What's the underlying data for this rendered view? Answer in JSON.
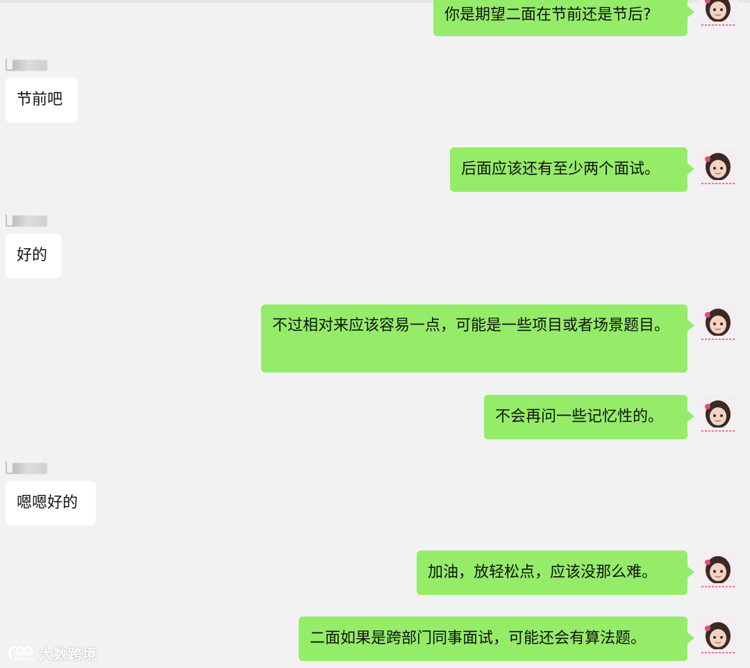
{
  "chat": {
    "messages": [
      {
        "side": "sent",
        "text": "你是期望二面在节前还是节后?"
      },
      {
        "side": "recv",
        "text": "节前吧"
      },
      {
        "side": "sent",
        "text": "后面应该还有至少两个面试。"
      },
      {
        "side": "recv",
        "text": "好的"
      },
      {
        "side": "sent",
        "text": "不过相对来应该容易一点，可能是一些项目或者场景题目。"
      },
      {
        "side": "sent",
        "text": "不会再问一些记忆性的。"
      },
      {
        "side": "recv",
        "text": "嗯嗯好的"
      },
      {
        "side": "sent",
        "text": "加油，放轻松点，应该没那么难。"
      },
      {
        "side": "sent",
        "text": "二面如果是跨部门同事面试，可能还会有算法题。"
      }
    ]
  },
  "watermark": {
    "text": "大数跨境",
    "icon": "brand-logo-icon"
  },
  "colors": {
    "background": "#f2f2f2",
    "sent_bubble": "#95ec69",
    "recv_bubble": "#ffffff",
    "text": "#111111"
  }
}
